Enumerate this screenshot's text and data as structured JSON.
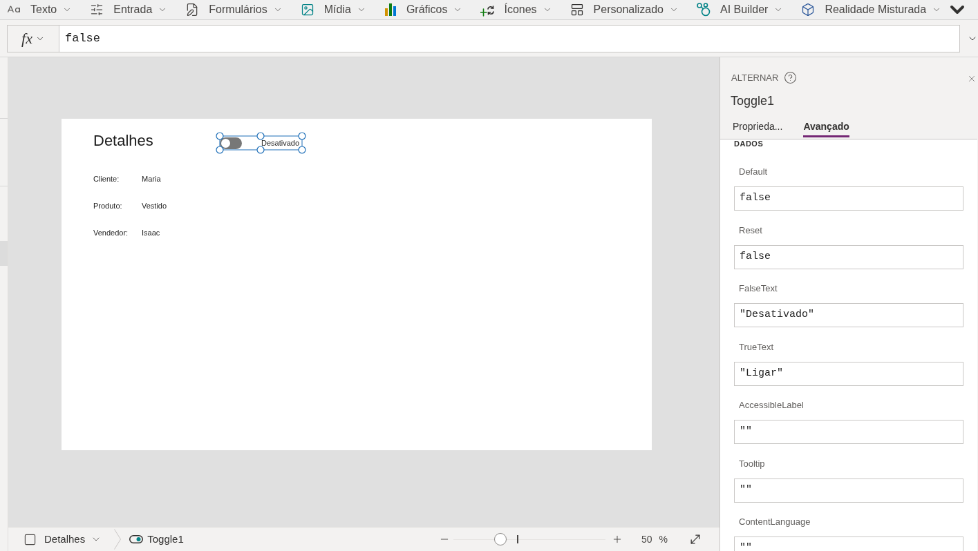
{
  "toolbar": {
    "items": [
      {
        "label": "Texto"
      },
      {
        "label": "Entrada"
      },
      {
        "label": "Formulários"
      },
      {
        "label": "Mídia"
      },
      {
        "label": "Gráficos"
      },
      {
        "label": "Ícones"
      },
      {
        "label": "Personalizado"
      },
      {
        "label": "AI Builder"
      },
      {
        "label": "Realidade Misturada"
      }
    ]
  },
  "formula_bar": {
    "function_label": "fx",
    "value": "false"
  },
  "canvas": {
    "screen": {
      "title": "Detalhes",
      "fields": [
        {
          "label": "Cliente:",
          "value": "Maria"
        },
        {
          "label": "Produto:",
          "value": "Vestido"
        },
        {
          "label": "Vendedor:",
          "value": "Isaac"
        }
      ],
      "toggle": {
        "checked": false,
        "selected": true,
        "label": "Desativado"
      }
    }
  },
  "properties_panel": {
    "control_type": "ALTERNAR",
    "control_name": "Toggle1",
    "tabs": [
      {
        "label": "Proprieda...",
        "selected": false
      },
      {
        "label": "Avançado",
        "selected": true
      }
    ],
    "section": "DADOS",
    "properties": [
      {
        "name": "Default",
        "value": "false"
      },
      {
        "name": "Reset",
        "value": "false"
      },
      {
        "name": "FalseText",
        "value": "\"Desativado\""
      },
      {
        "name": "TrueText",
        "value": "\"Ligar\""
      },
      {
        "name": "AccessibleLabel",
        "value": "\"\""
      },
      {
        "name": "Tooltip",
        "value": "\"\""
      },
      {
        "name": "ContentLanguage",
        "value": "\"\""
      }
    ]
  },
  "status_bar": {
    "screen": "Detalhes",
    "control": "Toggle1",
    "zoom": {
      "level": 0.31,
      "value": "50",
      "unit": "%"
    }
  }
}
